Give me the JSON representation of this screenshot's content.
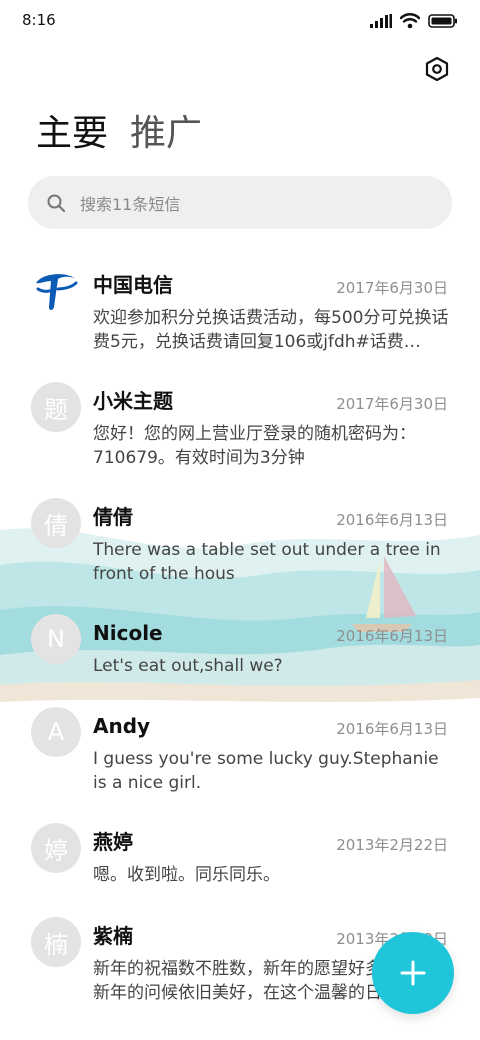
{
  "status_bar": {
    "time": "8:16"
  },
  "tabs": {
    "primary": "主要",
    "promotions": "推广"
  },
  "search": {
    "placeholder": "搜索11条短信"
  },
  "messages": [
    {
      "avatar": "",
      "name": "中国电信",
      "date": "2017年6月30日",
      "preview": "欢迎参加积分兑换话费活动，每500分可兑换话费5元，兑换话费请回复106或jfdh#话费…"
    },
    {
      "avatar": "题",
      "name": "小米主题",
      "date": "2017年6月30日",
      "preview": "您好！您的网上营业厅登录的随机密码为：710679。有效时间为3分钟"
    },
    {
      "avatar": "倩",
      "name": "倩倩",
      "date": "2016年6月13日",
      "preview": "There was a table set out under a tree in front of the hous"
    },
    {
      "avatar": "N",
      "name": "Nicole",
      "date": "2016年6月13日",
      "preview": "Let's eat out,shall we?"
    },
    {
      "avatar": "A",
      "name": "Andy",
      "date": "2016年6月13日",
      "preview": "I guess you're some lucky guy.Stephanie is a nice girl."
    },
    {
      "avatar": "婷",
      "name": "燕婷",
      "date": "2013年2月22日",
      "preview": "嗯。收到啦。同乐同乐。"
    },
    {
      "avatar": "楠",
      "name": "紫楠",
      "date": "2013年2月22日",
      "preview": "新年的祝福数不胜数，新年的愿望好多好多，新年的问候依旧美好，在这个温馨的日子里"
    }
  ],
  "colors": {
    "accent": "#1fc5d9",
    "avatar_bg": "#e3e3e3",
    "telecom_blue": "#0b5bb5"
  },
  "icons": {
    "settings": "settings-hexagon-icon",
    "search": "search-icon",
    "fab": "plus-icon"
  }
}
